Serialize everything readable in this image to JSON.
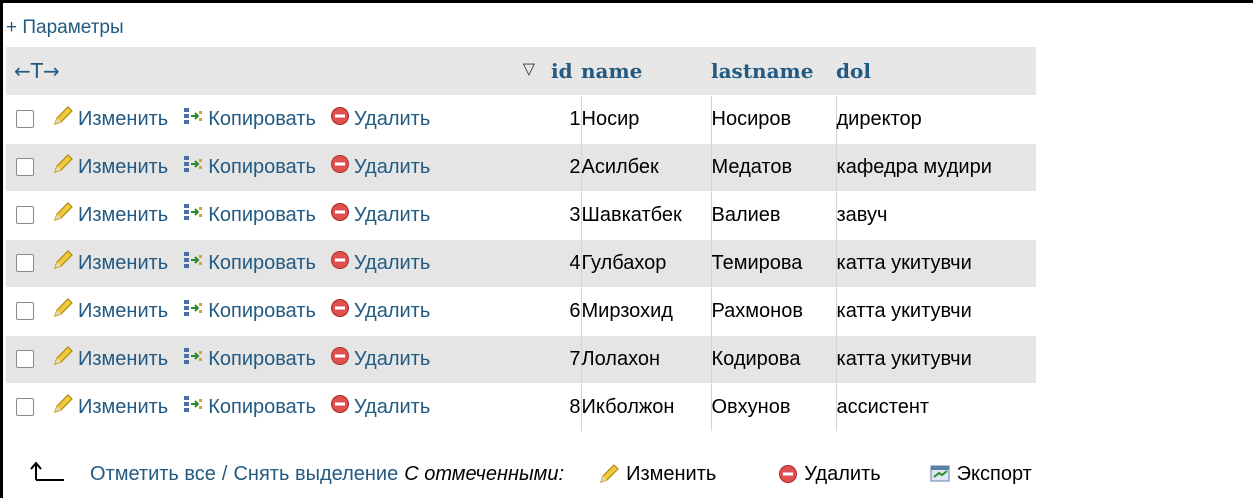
{
  "params_link": "+ Параметры",
  "header": {
    "arrows": "←T→",
    "sort_glyph": "▽",
    "columns": [
      "id",
      "name",
      "lastname",
      "dol"
    ]
  },
  "actions": {
    "edit": "Изменить",
    "copy": "Копировать",
    "delete": "Удалить"
  },
  "rows": [
    {
      "id": "1",
      "name": "Носир",
      "lastname": "Носиров",
      "dol": "директор"
    },
    {
      "id": "2",
      "name": "Асилбек",
      "lastname": "Медатов",
      "dol": "кафедра мудири"
    },
    {
      "id": "3",
      "name": "Шавкатбек",
      "lastname": "Валиев",
      "dol": "завуч"
    },
    {
      "id": "4",
      "name": "Гулбахор",
      "lastname": "Темирова",
      "dol": "катта укитувчи"
    },
    {
      "id": "6",
      "name": "Мирзохид",
      "lastname": "Рахмонов",
      "dol": "катта укитувчи"
    },
    {
      "id": "7",
      "name": "Лолахон",
      "lastname": "Кодирова",
      "dol": "катта укитувчи"
    },
    {
      "id": "8",
      "name": "Икболжон",
      "lastname": "Овхунов",
      "dol": "ассистент"
    }
  ],
  "footer": {
    "check_all": "Отметить все",
    "separator": "/",
    "uncheck_all": "Снять выделение",
    "with_selected": "С отмеченными:",
    "edit": "Изменить",
    "delete": "Удалить",
    "export": "Экспорт"
  },
  "colors": {
    "link": "#235a81",
    "row_alt": "#e5e5e5",
    "header_bg": "#e7e7e7",
    "delete_red": "#d9534f",
    "edit_yellow": "#e8b923"
  }
}
